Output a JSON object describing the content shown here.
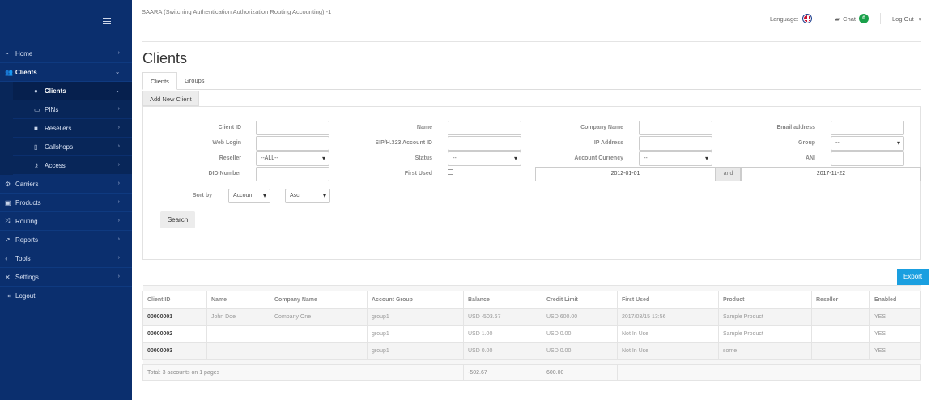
{
  "header": {
    "title": "SAARA (Switching Authentication Authorization Routing Accounting) -1",
    "language_label": "Language:",
    "chat_label": "Chat",
    "chat_count": "0",
    "logout_label": "Log Out"
  },
  "sidebar": {
    "items": [
      {
        "label": "Home",
        "icon": "dashboard-icon"
      },
      {
        "label": "Clients",
        "icon": "users-icon"
      },
      {
        "label": "Carriers",
        "icon": "gear-icon"
      },
      {
        "label": "Products",
        "icon": "box-icon"
      },
      {
        "label": "Routing",
        "icon": "shuffle-icon"
      },
      {
        "label": "Reports",
        "icon": "chart-icon"
      },
      {
        "label": "Tools",
        "icon": "tools-icon"
      },
      {
        "label": "Settings",
        "icon": "wrench-icon"
      },
      {
        "label": "Logout",
        "icon": "logout-icon"
      }
    ],
    "subitems": [
      {
        "label": "Clients",
        "icon": "user-icon"
      },
      {
        "label": "PINs",
        "icon": "card-icon"
      },
      {
        "label": "Resellers",
        "icon": "briefcase-icon"
      },
      {
        "label": "Callshops",
        "icon": "phone-icon"
      },
      {
        "label": "Access",
        "icon": "key-icon"
      }
    ]
  },
  "page": {
    "title": "Clients",
    "tabs": [
      "Clients",
      "Groups"
    ],
    "add_button": "Add New Client"
  },
  "filters": {
    "client_id": "Client ID",
    "web_login": "Web Login",
    "reseller": "Reseller",
    "reseller_value": "--ALL--",
    "did_number": "DID Number",
    "name": "Name",
    "sip_account": "SIP/H.323 Account ID",
    "status": "Status",
    "status_value": "--",
    "first_used": "First Used",
    "company_name": "Company Name",
    "ip_address": "IP Address",
    "account_currency": "Account Currency",
    "currency_value": "--",
    "email": "Email address",
    "group": "Group",
    "group_value": "--",
    "ani": "ANI",
    "date_from": "2012-01-01",
    "and_label": "and",
    "date_to": "2017-11-22",
    "sort_by": "Sort by",
    "sort_field": "Accoun",
    "sort_order": "Asc",
    "search_button": "Search"
  },
  "export_button": "Export",
  "table": {
    "columns": [
      "Client ID",
      "Name",
      "Company Name",
      "Account Group",
      "Balance",
      "Credit Limit",
      "First Used",
      "Product",
      "Reseller",
      "Enabled"
    ],
    "rows": [
      [
        "00000001",
        "John Doe",
        "Company One",
        "group1",
        "USD -503.67",
        "USD 600.00",
        "2017/03/15 13:56",
        "Sample Product",
        "",
        "YES"
      ],
      [
        "00000002",
        "",
        "",
        "group1",
        "USD 1.00",
        "USD 0.00",
        "Not In Use",
        "Sample Product",
        "",
        "YES"
      ],
      [
        "00000003",
        "",
        "",
        "group1",
        "USD 0.00",
        "USD 0.00",
        "Not In Use",
        "some",
        "",
        "YES"
      ]
    ],
    "total_label": "Total: 3 accounts on 1 pages",
    "total_balance": "-502.67",
    "total_credit": "600.00"
  }
}
